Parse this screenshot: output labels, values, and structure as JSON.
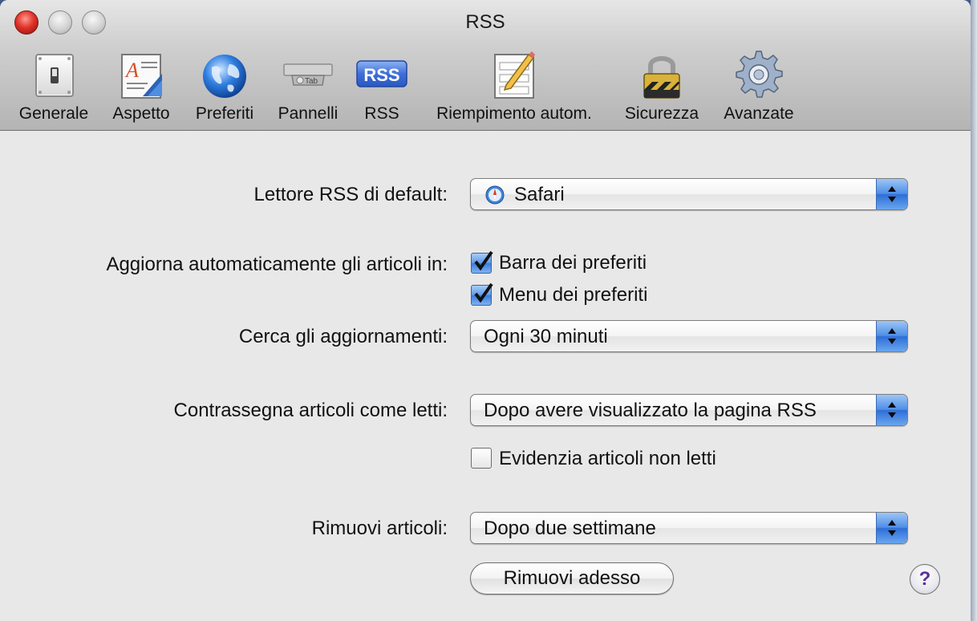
{
  "window": {
    "title": "RSS"
  },
  "toolbar": {
    "items": [
      {
        "label": "Generale",
        "icon": "switch-icon"
      },
      {
        "label": "Aspetto",
        "icon": "appearance-icon"
      },
      {
        "label": "Preferiti",
        "icon": "globe-icon"
      },
      {
        "label": "Pannelli",
        "icon": "tabs-icon"
      },
      {
        "label": "RSS",
        "icon": "rss-icon",
        "selected": true
      },
      {
        "label": "Riempimento autom.",
        "icon": "autofill-icon"
      },
      {
        "label": "Sicurezza",
        "icon": "lock-icon"
      },
      {
        "label": "Avanzate",
        "icon": "gear-icon"
      }
    ],
    "tab_icon_text": "Tab",
    "rss_icon_text": "RSS"
  },
  "settings": {
    "default_reader": {
      "label": "Lettore RSS di default:",
      "value": "Safari"
    },
    "auto_update": {
      "label": "Aggiorna automaticamente gli articoli in:",
      "options": [
        {
          "label": "Barra dei preferiti",
          "checked": true
        },
        {
          "label": "Menu dei preferiti",
          "checked": true
        }
      ]
    },
    "check_updates": {
      "label": "Cerca gli aggiornamenti:",
      "value": "Ogni 30 minuti"
    },
    "mark_read": {
      "label": "Contrassegna articoli come letti:",
      "value": "Dopo avere visualizzato la pagina RSS"
    },
    "highlight_unread": {
      "label": "Evidenzia articoli non letti",
      "checked": false
    },
    "remove_articles": {
      "label": "Rimuovi articoli:",
      "value": "Dopo due settimane"
    },
    "remove_now_button": "Rimuovi adesso",
    "help_button": "?"
  }
}
